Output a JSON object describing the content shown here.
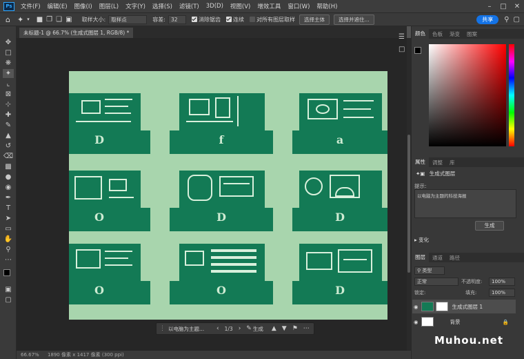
{
  "app": {
    "logo": "Ps"
  },
  "menu": [
    "文件(F)",
    "编辑(E)",
    "图像(I)",
    "图层(L)",
    "文字(Y)",
    "选择(S)",
    "滤镜(T)",
    "3D(D)",
    "视图(V)",
    "增效工具",
    "窗口(W)",
    "帮助(H)"
  ],
  "options": {
    "sample_size_label": "取样大小:",
    "sample_size_value": "取样点",
    "tolerance_label": "容差:",
    "tolerance_value": "32",
    "antialias_label": "消除锯齿",
    "contiguous_label": "连续",
    "all_layers_label": "对所有图层取样",
    "select_subject": "选择主体",
    "select_and_mask": "选择并遮住...",
    "share": "共享"
  },
  "document": {
    "tab_title": "未标题-1 @ 66.7% (生成式图层 1, RGB/8) *",
    "letters": [
      "D",
      "f",
      "a",
      "O",
      "D",
      "D",
      "O",
      "O",
      "D"
    ]
  },
  "contextbar": {
    "prompt": "以电脑为主题...",
    "page": "1/3",
    "generate": "生成"
  },
  "status": {
    "zoom": "66.67%",
    "info": "1890 像素 x 1417 像素 (300 ppi)"
  },
  "panels": {
    "color_tabs": [
      "颜色",
      "色板",
      "渐变",
      "图案"
    ],
    "props_tabs": [
      "属性",
      "调整",
      "库"
    ],
    "props_type": "生成式图层",
    "prompt_label": "提示:",
    "prompt_text": "以电脑为主题的科技海报",
    "generate": "生成",
    "variations": "变化",
    "layers_tabs": [
      "图层",
      "通道",
      "路径"
    ],
    "kind": "类型",
    "blend": "正常",
    "opacity_label": "不透明度:",
    "opacity": "100%",
    "lock_label": "锁定:",
    "fill_label": "填充:",
    "fill": "100%",
    "layers": [
      {
        "name": "生成式图层 1"
      },
      {
        "name": "背景"
      }
    ]
  },
  "watermark": "Muhou.net",
  "colors": {
    "canvas_bg": "#a8d5ad",
    "card": "#137a55",
    "accent": "#1473e6"
  }
}
